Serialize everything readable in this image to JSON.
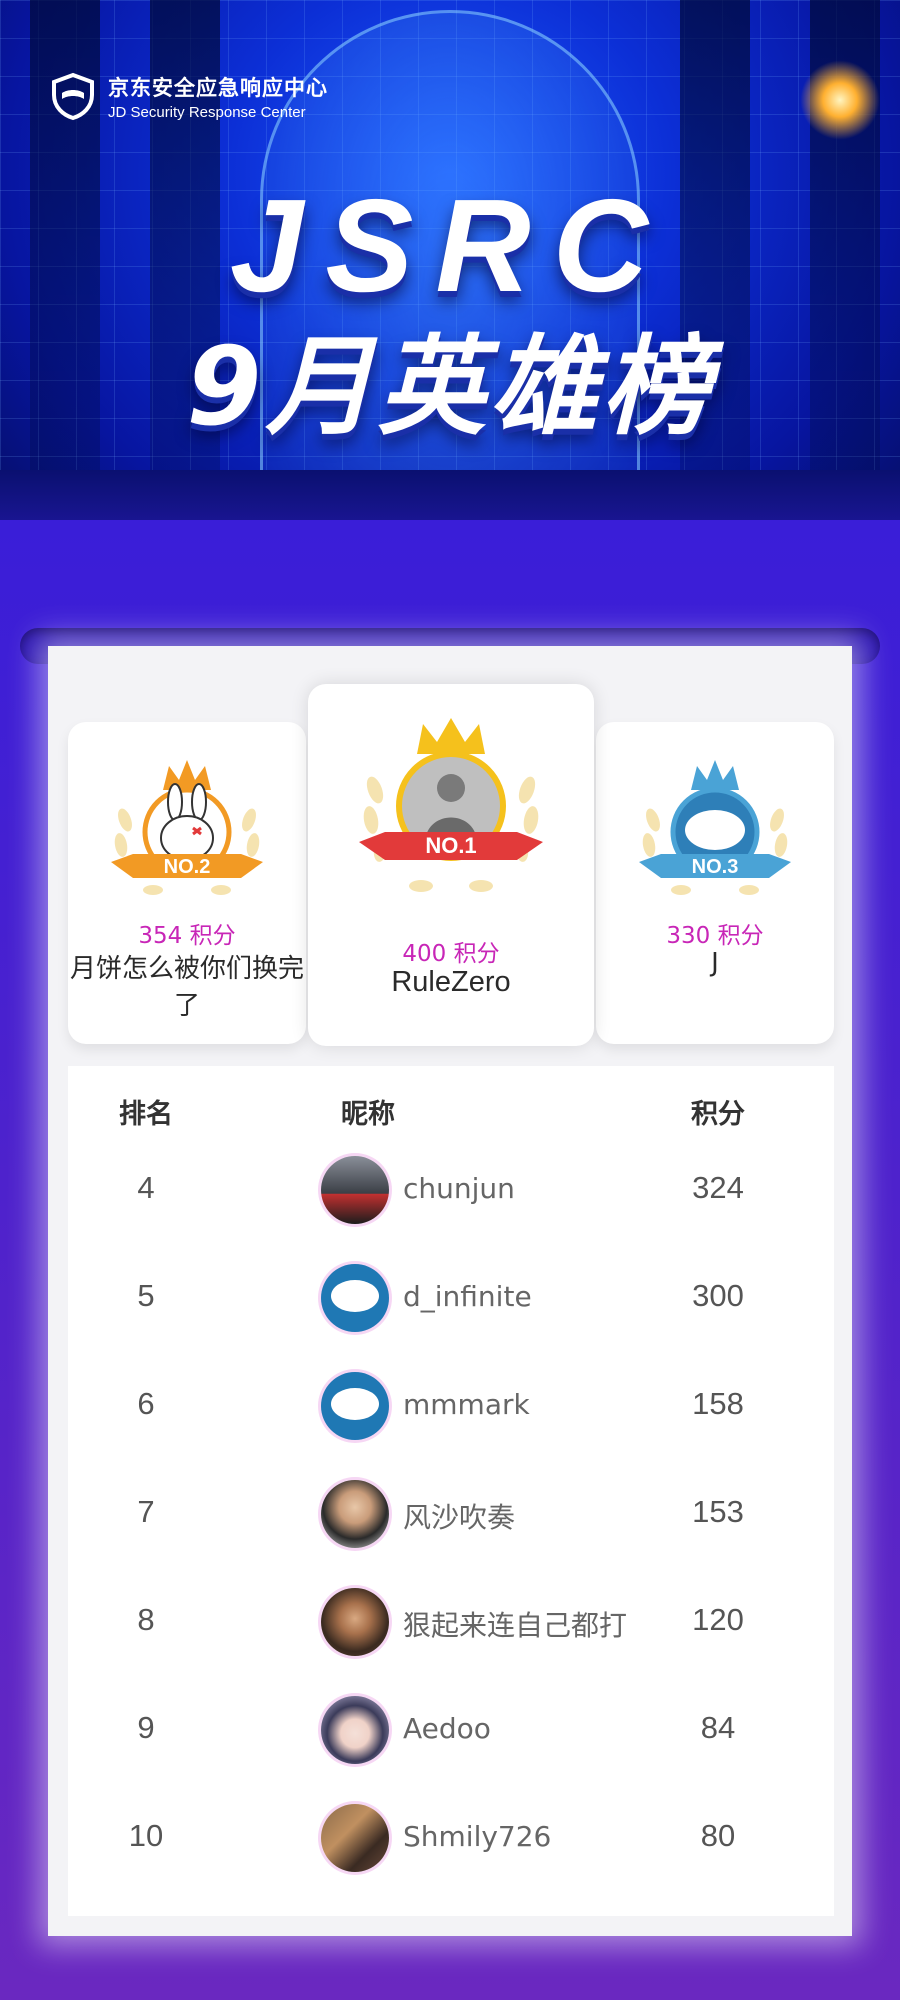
{
  "brand": {
    "name_cn": "京东安全应急响应中心",
    "name_en": "JD Security Response Center"
  },
  "headline": {
    "line1": "JSRC",
    "line2": "9月英雄榜"
  },
  "top3": [
    {
      "rank_label": "NO.2",
      "score": "354 积分",
      "name": "月饼怎么被你们换完了",
      "ribbon_color": "#f29a24"
    },
    {
      "rank_label": "NO.1",
      "score": "400 积分",
      "name": "RuleZero",
      "ribbon_color": "#e23a3a"
    },
    {
      "rank_label": "NO.3",
      "score": "330 积分",
      "name": "J",
      "ribbon_color": "#4aa3d6"
    }
  ],
  "table": {
    "headers": {
      "rank": "排名",
      "nickname": "昵称",
      "score": "积分"
    },
    "rows": [
      {
        "rank": "4",
        "name": "chunjun",
        "score": "324",
        "avatar": "car-avatar"
      },
      {
        "rank": "5",
        "name": "d_infinite",
        "score": "300",
        "avatar": "default-avatar"
      },
      {
        "rank": "6",
        "name": "mmmark",
        "score": "158",
        "avatar": "default-avatar"
      },
      {
        "rank": "7",
        "name": "风沙吹奏",
        "score": "153",
        "avatar": "person-avatar"
      },
      {
        "rank": "8",
        "name": "狠起来连自己都打",
        "score": "120",
        "avatar": "person-avatar"
      },
      {
        "rank": "9",
        "name": "Aedoo",
        "score": "84",
        "avatar": "anime-avatar"
      },
      {
        "rank": "10",
        "name": "Shmily726",
        "score": "80",
        "avatar": "photo-avatar"
      }
    ]
  },
  "colors": {
    "score_magenta": "#c826b7",
    "frame_purple": "#4e22cc",
    "gold": "#f5c11c"
  }
}
